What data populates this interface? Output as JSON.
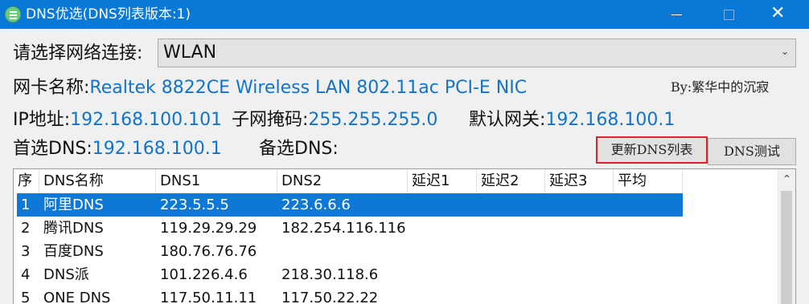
{
  "window": {
    "title": "DNS优选(DNS列表版本:1)"
  },
  "connection": {
    "label": "请选择网络连接:",
    "selected": "WLAN"
  },
  "nic": {
    "label": "网卡名称:",
    "value": "Realtek 8822CE Wireless LAN 802.11ac PCI-E NIC"
  },
  "author": "By:繁华中的沉寂",
  "ip": {
    "label": "IP地址:",
    "value": "192.168.100.101"
  },
  "mask": {
    "label": "子网掩码:",
    "value": "255.255.255.0"
  },
  "gateway": {
    "label": "默认网关:",
    "value": "192.168.100.1"
  },
  "primary_dns": {
    "label": "首选DNS:",
    "value": "192.168.100.1"
  },
  "secondary_dns": {
    "label": "备选DNS:",
    "value": ""
  },
  "buttons": {
    "refresh": "更新DNS列表",
    "test": "DNS测试"
  },
  "list": {
    "columns": [
      "序",
      "DNS名称",
      "DNS1",
      "DNS2",
      "延迟1",
      "延迟2",
      "延迟3",
      "平均"
    ],
    "rows": [
      {
        "no": "1",
        "name": "阿里DNS",
        "dns1": "223.5.5.5",
        "dns2": "223.6.6.6",
        "selected": true
      },
      {
        "no": "2",
        "name": "腾讯DNS",
        "dns1": "119.29.29.29",
        "dns2": "182.254.116.116"
      },
      {
        "no": "3",
        "name": "百度DNS",
        "dns1": "180.76.76.76",
        "dns2": ""
      },
      {
        "no": "4",
        "name": "DNS派",
        "dns1": "101.226.4.6",
        "dns2": "218.30.118.6"
      },
      {
        "no": "5",
        "name": "ONE DNS",
        "dns1": "117.50.11.11",
        "dns2": "117.50.22.22"
      }
    ]
  },
  "colors": {
    "titlebar": "#0a78d7",
    "value_text": "#1174c8",
    "selection": "#0f78d7",
    "highlight_border": "#d7262a"
  }
}
